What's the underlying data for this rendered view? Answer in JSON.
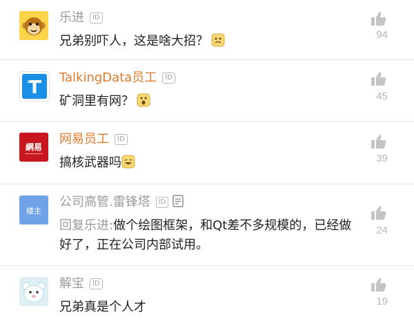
{
  "comments": [
    {
      "author": "乐进",
      "author_badge": "ID",
      "text": "兄弟别吓人，这是啥大招？",
      "likes": "94",
      "avatar_icon": "monkey-face-icon",
      "emoji_icon": "confused-face-emoji"
    },
    {
      "author": "TalkingData员工",
      "author_badge": "ID",
      "text": "矿洞里有网？",
      "likes": "45",
      "avatar_icon": "talkingdata-logo",
      "emoji_icon": "shocked-face-emoji"
    },
    {
      "author": "网易员工",
      "author_badge": "ID",
      "text": "搞核武器吗",
      "likes": "39",
      "avatar_icon": "netease-logo",
      "avatar_text": "網易",
      "emoji_icon": "laughing-face-emoji"
    },
    {
      "author": "公司高管.雷锋塔",
      "author_badge": "ID",
      "reply_prefix": "回复乐进:",
      "text": "做个绘图框架，和Qt差不多规模的，已经做好了，正在公司内部试用。",
      "likes": "24",
      "avatar_icon": "building-owner-avatar",
      "avatar_text": "楼主"
    },
    {
      "author": "解宝",
      "author_badge": "ID",
      "text": "兄弟真是个人才",
      "likes": "19",
      "avatar_icon": "cartoon-animal-avatar"
    }
  ],
  "colors": {
    "name_gray": "#9a9a9a",
    "name_orange": "#e07a2c",
    "like_gray": "#b5b5b5",
    "talkingdata_blue": "#1a8fe6",
    "netease_red": "#c8161e",
    "owner_blue": "#6fa3e8"
  }
}
